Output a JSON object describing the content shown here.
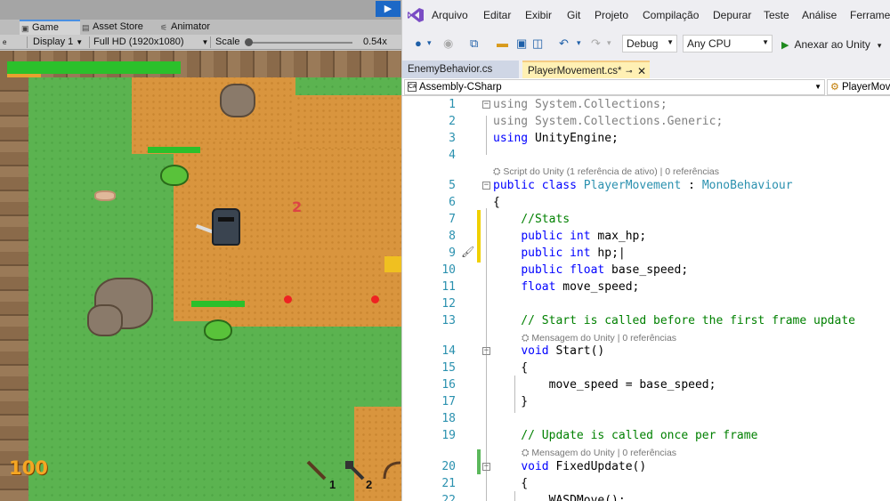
{
  "unity": {
    "tabs": [
      "Game",
      "Asset Store",
      "Animator"
    ],
    "toolbar": {
      "display": "Display 1",
      "resolution": "Full HD (1920x1080)",
      "scale_label": "Scale",
      "scale_value": "0.54x"
    },
    "game": {
      "player_hp_display": "100",
      "damage_popup": "2",
      "weapon_slot_1": "1",
      "weapon_slot_2": "2"
    }
  },
  "vs": {
    "menu": [
      "Arquivo",
      "Editar",
      "Exibir",
      "Git",
      "Projeto",
      "Compilação",
      "Depurar",
      "Teste",
      "Análise",
      "Ferramen"
    ],
    "toolbar": {
      "configuration": "Debug",
      "platform": "Any CPU",
      "attach": "Anexar ao Unity"
    },
    "tabs": [
      {
        "label": "EnemyBehavior.cs",
        "active": false
      },
      {
        "label": "PlayerMovement.cs*",
        "active": true
      }
    ],
    "nav": {
      "project": "Assembly-CSharp",
      "member": "PlayerMovement"
    },
    "lens": {
      "unity_script": "Script do Unity (1 referência de ativo) | 0 referências",
      "unity_message": "Mensagem do Unity | 0 referências"
    },
    "code_lines": [
      {
        "n": "1",
        "text": "using System.Collections;"
      },
      {
        "n": "2",
        "text": "using System.Collections.Generic;"
      },
      {
        "n": "3",
        "text": "using UnityEngine;"
      },
      {
        "n": "4",
        "text": ""
      },
      {
        "n": "5",
        "text": "public class PlayerMovement : MonoBehaviour"
      },
      {
        "n": "6",
        "text": "{"
      },
      {
        "n": "7",
        "text": "    //Stats"
      },
      {
        "n": "8",
        "text": "    public int max_hp;"
      },
      {
        "n": "9",
        "text": "    public int hp;"
      },
      {
        "n": "10",
        "text": "    public float base_speed;"
      },
      {
        "n": "11",
        "text": "    float move_speed;"
      },
      {
        "n": "12",
        "text": ""
      },
      {
        "n": "13",
        "text": "    // Start is called before the first frame update"
      },
      {
        "n": "14",
        "text": "    void Start()"
      },
      {
        "n": "15",
        "text": "    {"
      },
      {
        "n": "16",
        "text": "        move_speed = base_speed;"
      },
      {
        "n": "17",
        "text": "    }"
      },
      {
        "n": "18",
        "text": ""
      },
      {
        "n": "19",
        "text": "    // Update is called once per frame"
      },
      {
        "n": "20",
        "text": "    void FixedUpdate()"
      },
      {
        "n": "21",
        "text": "    {"
      },
      {
        "n": "22",
        "text": "        WASDMove();"
      }
    ]
  }
}
